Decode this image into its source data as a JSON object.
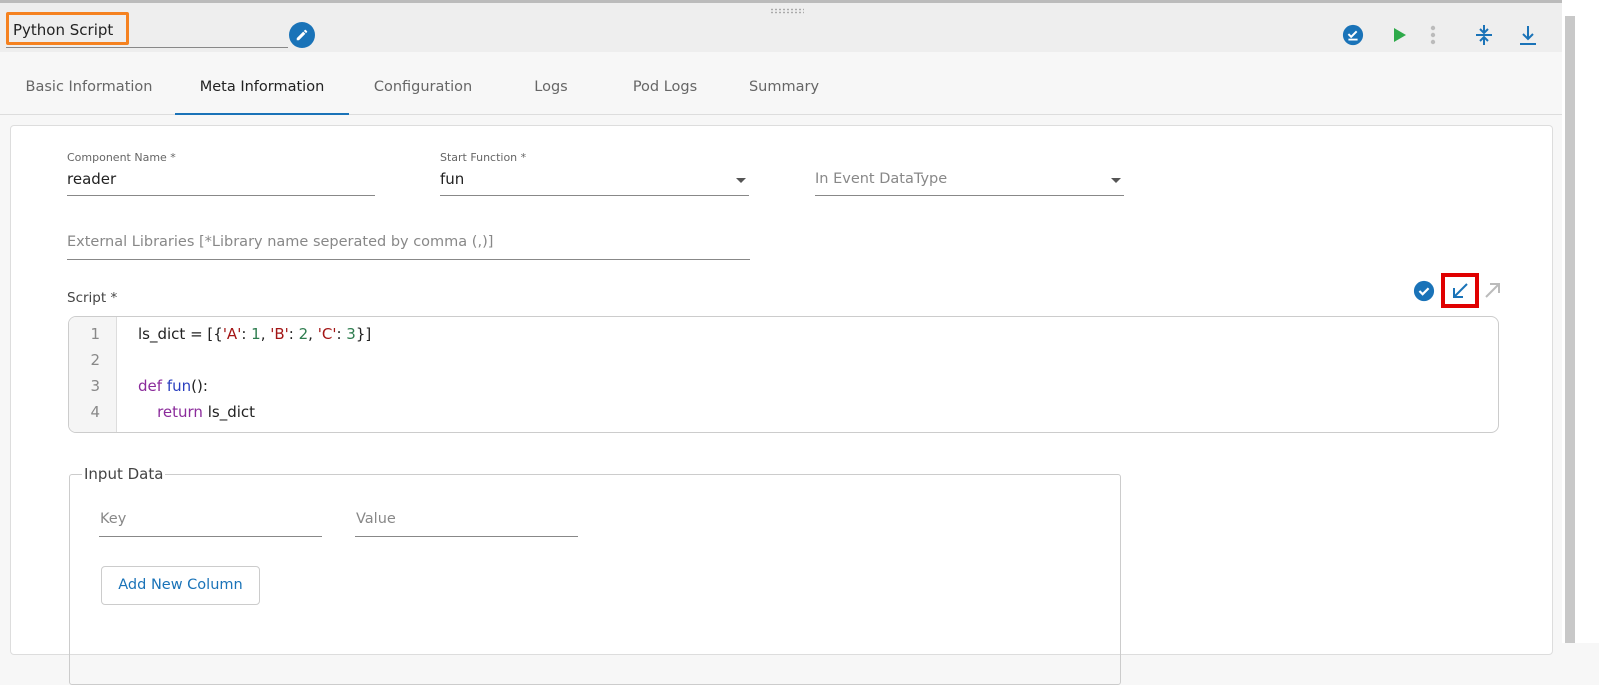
{
  "header": {
    "title": "Python Script"
  },
  "tabs": [
    "Basic Information",
    "Meta Information",
    "Configuration",
    "Logs",
    "Pod Logs",
    "Summary"
  ],
  "active_tab": "Meta Information",
  "form": {
    "component_name": {
      "label": "Component Name *",
      "value": "reader"
    },
    "start_function": {
      "label": "Start Function *",
      "value": "fun"
    },
    "in_event_datatype": {
      "placeholder": "In Event DataType"
    },
    "external_libraries": {
      "placeholder": "External Libraries [*Library name seperated by comma (,)]"
    },
    "script_label": "Script *"
  },
  "script": {
    "line_numbers": [
      "1",
      "2",
      "3",
      "4"
    ],
    "lines": [
      [
        [
          "plain",
          "ls_dict = [{"
        ],
        [
          "str",
          "'A'"
        ],
        [
          "plain",
          ": "
        ],
        [
          "num",
          "1"
        ],
        [
          "plain",
          ", "
        ],
        [
          "str",
          "'B'"
        ],
        [
          "plain",
          ": "
        ],
        [
          "num",
          "2"
        ],
        [
          "plain",
          ", "
        ],
        [
          "str",
          "'C'"
        ],
        [
          "plain",
          ": "
        ],
        [
          "num",
          "3"
        ],
        [
          "plain",
          "}]"
        ]
      ],
      [],
      [
        [
          "kw",
          "def"
        ],
        [
          "plain",
          " "
        ],
        [
          "fn",
          "fun"
        ],
        [
          "plain",
          "():"
        ]
      ],
      [
        [
          "plain",
          "    "
        ],
        [
          "kw",
          "return"
        ],
        [
          "plain",
          " ls_dict"
        ]
      ]
    ]
  },
  "input_data": {
    "legend": "Input Data",
    "key_placeholder": "Key",
    "value_placeholder": "Value",
    "add_button": "Add New Column"
  },
  "colors": {
    "accent": "#1a73b8",
    "highlight_orange": "#f58220",
    "highlight_red": "#e00000",
    "run_green": "#2eaa4a"
  }
}
